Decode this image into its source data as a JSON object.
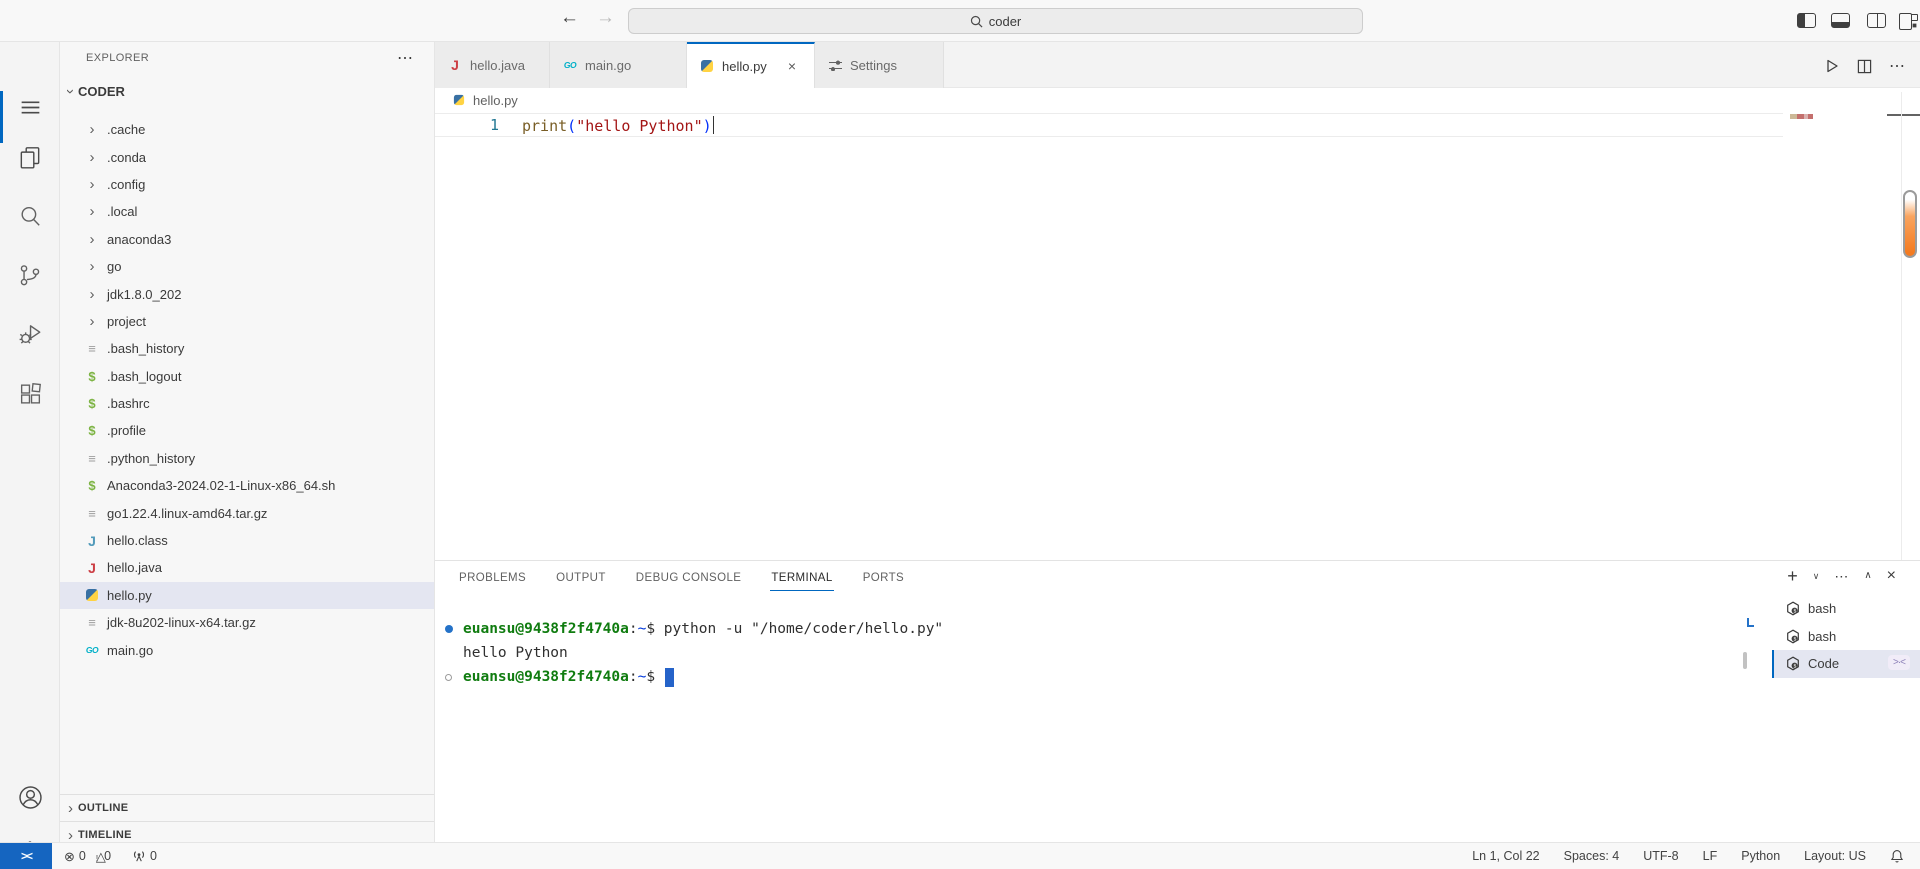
{
  "colors": {
    "accent_blue": "#0067c0",
    "selection_bg": "#e4e6f1",
    "remote_blue": "#1565c0",
    "terminal_green": "#107c10",
    "terminal_path_blue": "#0037da",
    "token_function": "#795e26",
    "token_string": "#a31515",
    "token_bracket": "#0431fa",
    "line_number": "#237893",
    "scroll_pill_orange": "#f47b20"
  },
  "icons": {
    "titlebar": [
      "back-arrow",
      "forward-arrow",
      "search-magnifier",
      "toggle-sidebar",
      "toggle-panel",
      "split-editor",
      "customize-layout"
    ],
    "activitybar": [
      "menu",
      "files-explorer",
      "search",
      "source-control",
      "run-debug",
      "extensions",
      "account",
      "settings-gear"
    ],
    "editor_actions": [
      "run-triangle",
      "split-editor",
      "more-ellipsis"
    ],
    "panel_actions": [
      "new-terminal-plus",
      "launch-profile-chevron",
      "more-ellipsis",
      "maximize-panel-chevron",
      "close-panel-x"
    ],
    "statusbar": [
      "remote-indicator",
      "error-circle",
      "warning-triangle",
      "ports-tower",
      "bell"
    ]
  },
  "titlebar": {
    "search_value": "coder"
  },
  "explorer": {
    "title": "EXPLORER",
    "root_label": "CODER",
    "outline_label": "OUTLINE",
    "timeline_label": "TIMELINE",
    "items": [
      {
        "label": ".cache",
        "icon": "folder"
      },
      {
        "label": ".conda",
        "icon": "folder"
      },
      {
        "label": ".config",
        "icon": "folder"
      },
      {
        "label": ".local",
        "icon": "folder"
      },
      {
        "label": "anaconda3",
        "icon": "folder"
      },
      {
        "label": "go",
        "icon": "folder"
      },
      {
        "label": "jdk1.8.0_202",
        "icon": "folder"
      },
      {
        "label": "project",
        "icon": "folder"
      },
      {
        "label": ".bash_history",
        "icon": "text"
      },
      {
        "label": ".bash_logout",
        "icon": "shell"
      },
      {
        "label": ".bashrc",
        "icon": "shell"
      },
      {
        "label": ".profile",
        "icon": "shell"
      },
      {
        "label": ".python_history",
        "icon": "text"
      },
      {
        "label": "Anaconda3-2024.02-1-Linux-x86_64.sh",
        "icon": "shell"
      },
      {
        "label": "go1.22.4.linux-amd64.tar.gz",
        "icon": "text"
      },
      {
        "label": "hello.class",
        "icon": "java-blue"
      },
      {
        "label": "hello.java",
        "icon": "java-red"
      },
      {
        "label": "hello.py",
        "icon": "python"
      },
      {
        "label": "jdk-8u202-linux-x64.tar.gz",
        "icon": "text"
      },
      {
        "label": "main.go",
        "icon": "go"
      }
    ]
  },
  "tabs": {
    "items": [
      {
        "label": "hello.java",
        "icon": "java-red"
      },
      {
        "label": "main.go",
        "icon": "go"
      },
      {
        "label": "hello.py",
        "icon": "python",
        "close_label": "×"
      },
      {
        "label": "Settings",
        "icon": "sliders"
      }
    ]
  },
  "breadcrumb": {
    "icon": "python",
    "file_label": "hello.py"
  },
  "editor": {
    "line_number": "1",
    "tokens": [
      {
        "text": "print"
      },
      {
        "text": "("
      },
      {
        "text": "\"hello Python\""
      },
      {
        "text": ")"
      }
    ]
  },
  "panel": {
    "tabs": [
      {
        "label": "PROBLEMS"
      },
      {
        "label": "OUTPUT"
      },
      {
        "label": "DEBUG CONSOLE"
      },
      {
        "label": "TERMINAL"
      },
      {
        "label": "PORTS"
      }
    ]
  },
  "terminal": {
    "prompt_user": "euansu@9438f2f4740a",
    "prompt_colon": ":",
    "prompt_path": "~",
    "prompt_symbol": "$",
    "command": " python -u \"/home/coder/hello.py\"",
    "output": "hello Python",
    "list": [
      {
        "label": "bash"
      },
      {
        "label": "bash"
      },
      {
        "label": "Code"
      }
    ]
  },
  "statusbar": {
    "remote": "><",
    "errors": "0",
    "warnings": "0",
    "ports": "0",
    "line_col": "Ln 1, Col 22",
    "spaces": "Spaces: 4",
    "encoding": "UTF-8",
    "eol": "LF",
    "language": "Python",
    "layout": "Layout: US"
  }
}
